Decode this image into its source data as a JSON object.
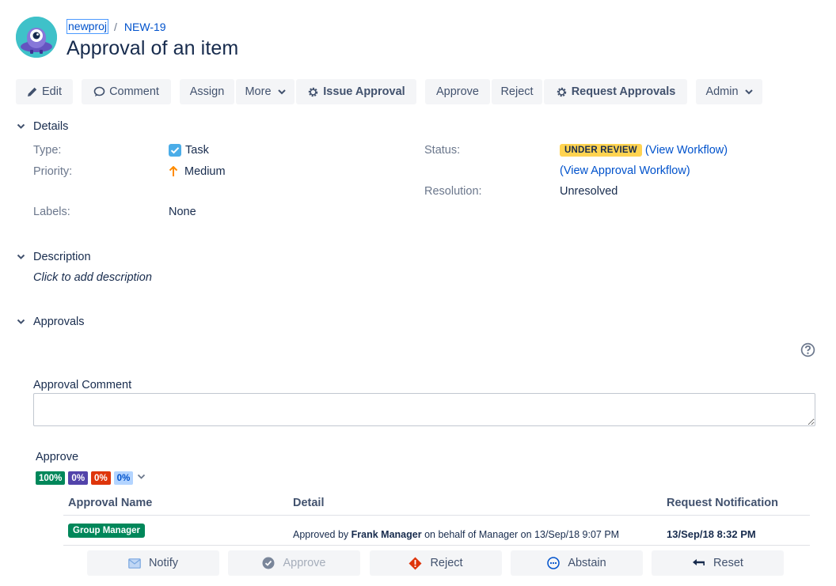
{
  "header": {
    "project": "newproj",
    "separator": "/",
    "issue_key": "NEW-19",
    "title": "Approval of an item"
  },
  "toolbar": {
    "edit": "Edit",
    "comment": "Comment",
    "assign": "Assign",
    "more": "More",
    "issue_approval": "Issue Approval",
    "approve": "Approve",
    "reject": "Reject",
    "request_approvals": "Request Approvals",
    "admin": "Admin"
  },
  "details": {
    "heading": "Details",
    "type_label": "Type:",
    "type_value": "Task",
    "priority_label": "Priority:",
    "priority_value": "Medium",
    "labels_label": "Labels:",
    "labels_value": "None",
    "status_label": "Status:",
    "status_value": "UNDER REVIEW",
    "view_workflow": "(View Workflow)",
    "view_approval_workflow": "(View Approval Workflow)",
    "resolution_label": "Resolution:",
    "resolution_value": "Unresolved"
  },
  "description": {
    "heading": "Description",
    "placeholder": "Click to add description"
  },
  "approvals": {
    "heading": "Approvals",
    "comment_label": "Approval Comment",
    "comment_value": "",
    "group_label": "Approve",
    "percentages": [
      {
        "text": "100%",
        "color": "#00875a"
      },
      {
        "text": "0%",
        "color": "#5243aa"
      },
      {
        "text": "0%",
        "color": "#de350b"
      },
      {
        "text": "0%",
        "color": "#b3d4ff"
      }
    ],
    "columns": {
      "name": "Approval Name",
      "detail": "Detail",
      "notification": "Request Notification"
    },
    "row": {
      "name": "Group Manager",
      "detail_prefix": "Approved by ",
      "detail_user": "Frank Manager",
      "detail_suffix": " on behalf of Manager on 13/Sep/18 9:07 PM",
      "notification": "13/Sep/18 8:32 PM"
    },
    "actions": {
      "notify": "Notify",
      "approve": "Approve",
      "reject": "Reject",
      "abstain": "Abstain",
      "reset": "Reset"
    }
  },
  "colors": {
    "link": "#0052cc",
    "status_bg": "#ffd351",
    "group_badge": "#00875a"
  }
}
